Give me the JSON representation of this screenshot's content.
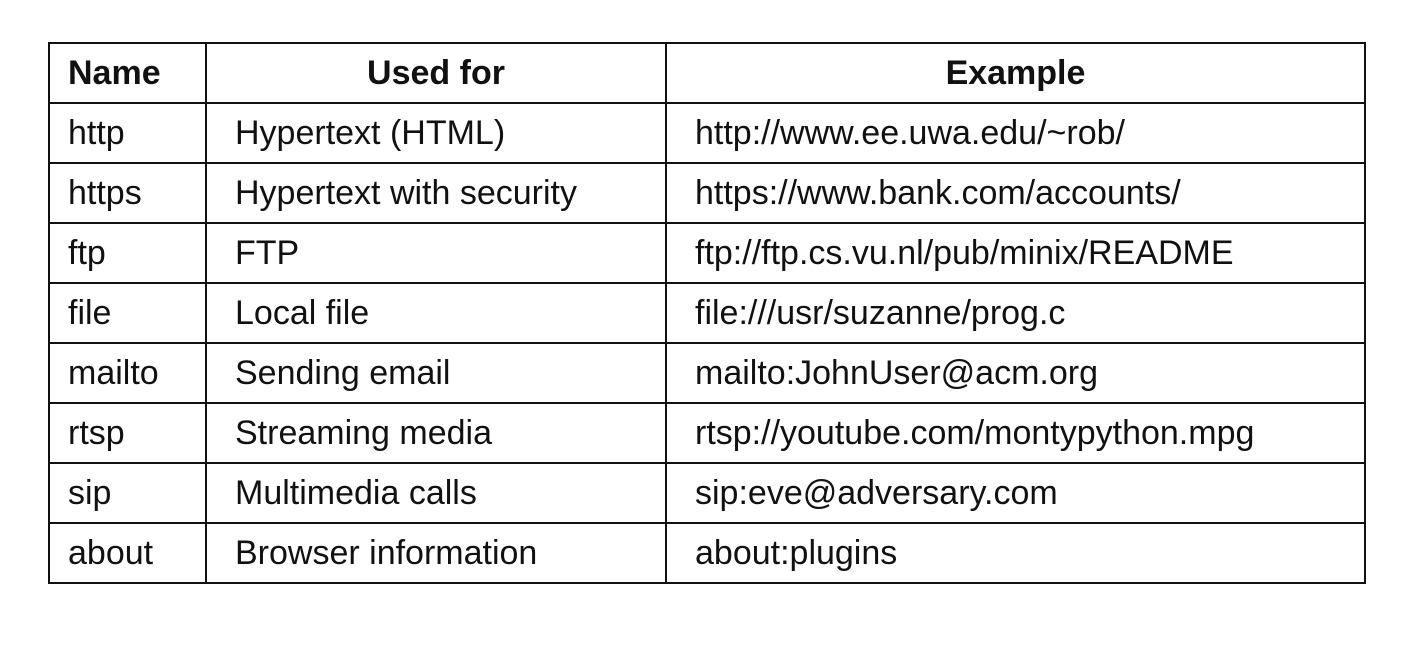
{
  "table": {
    "headers": [
      "Name",
      "Used for",
      "Example"
    ],
    "rows": [
      [
        "http",
        "Hypertext (HTML)",
        "http://www.ee.uwa.edu/~rob/"
      ],
      [
        "https",
        "Hypertext with security",
        "https://www.bank.com/accounts/"
      ],
      [
        "ftp",
        "FTP",
        "ftp://ftp.cs.vu.nl/pub/minix/README"
      ],
      [
        "file",
        "Local file",
        "file:///usr/suzanne/prog.c"
      ],
      [
        "mailto",
        "Sending email",
        "mailto:JohnUser@acm.org"
      ],
      [
        "rtsp",
        "Streaming media",
        "rtsp://youtube.com/montypython.mpg"
      ],
      [
        "sip",
        "Multimedia calls",
        "sip:eve@adversary.com"
      ],
      [
        "about",
        "Browser information",
        "about:plugins"
      ]
    ]
  }
}
